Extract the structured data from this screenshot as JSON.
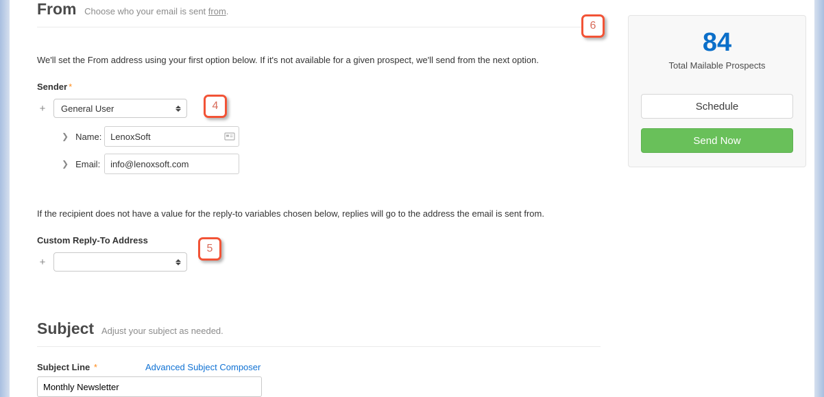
{
  "from_section": {
    "title": "From",
    "subtitle_prefix": "Choose who your email is sent ",
    "subtitle_underlined": "from",
    "subtitle_suffix": ".",
    "description": "We'll set the From address using your first option below. If it's not available for a given prospect, we'll send from the next option.",
    "sender_label": "Sender",
    "sender_dropdown_value": "General User",
    "name_label": "Name:",
    "name_value": "LenoxSoft",
    "email_label": "Email:",
    "email_value": "info@lenoxsoft.com",
    "reply_description": "If the recipient does not have a value for the reply-to variables chosen below, replies will go to the address the email is sent from.",
    "reply_to_label": "Custom Reply-To Address",
    "reply_to_dropdown_value": ""
  },
  "subject_section": {
    "title": "Subject",
    "subtitle": "Adjust your subject as needed.",
    "subject_line_label": "Subject Line",
    "composer_link": "Advanced Subject Composer",
    "subject_value": "Monthly Newsletter"
  },
  "side_panel": {
    "count": "84",
    "count_label": "Total Mailable Prospects",
    "schedule_label": "Schedule",
    "send_now_label": "Send Now"
  },
  "callouts": {
    "c4": "4",
    "c5": "5",
    "c6": "6"
  }
}
